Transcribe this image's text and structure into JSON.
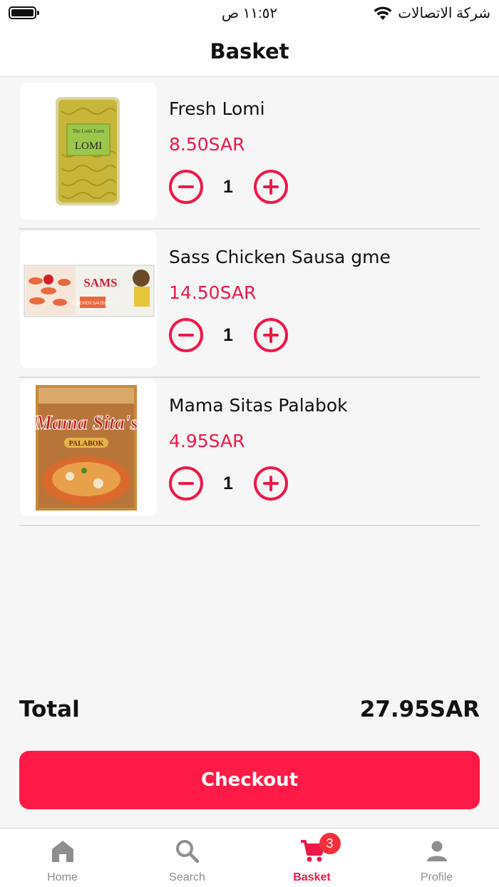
{
  "status_bar": {
    "time": "١١:٥٢ ص",
    "carrier": "شركة الاتصالات",
    "icons": [
      "battery-icon",
      "wifi-icon"
    ]
  },
  "header": {
    "title": "Basket"
  },
  "items": [
    {
      "name": "Fresh Lomi",
      "price": "8.50SAR",
      "quantity": "1",
      "thumb_text": "LOMI",
      "thumb_brand": "The Lomi Farm"
    },
    {
      "name": "Sass Chicken Sausa gme",
      "price": "14.50SAR",
      "quantity": "1",
      "thumb_text": "SAMS",
      "thumb_sub": "CHICKEN SAUSAGE"
    },
    {
      "name": "Mama Sitas Palabok",
      "price": "4.95SAR",
      "quantity": "1",
      "thumb_text": "Mama Sita's",
      "thumb_sub": "PALABOK"
    }
  ],
  "total": {
    "label": "Total",
    "value": "27.95SAR"
  },
  "checkout": {
    "label": "Checkout"
  },
  "tabs": [
    {
      "label": "Home",
      "icon": "home-icon"
    },
    {
      "label": "Search",
      "icon": "search-icon"
    },
    {
      "label": "Basket",
      "icon": "cart-icon",
      "badge": "3",
      "active": true
    },
    {
      "label": "Profile",
      "icon": "person-icon"
    }
  ],
  "colors": {
    "accent": "#f0184a",
    "checkout": "#ff1a47",
    "badge": "#f3303c",
    "tab_inactive": "#8e8e8e"
  }
}
